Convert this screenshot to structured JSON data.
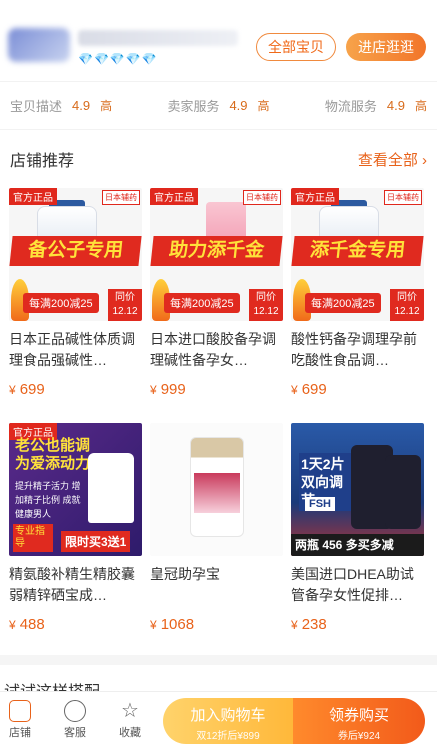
{
  "header": {
    "rating_diamonds": "💎💎💎💎💎",
    "all_products_label": "全部宝贝",
    "visit_shop_label": "进店逛逛"
  },
  "ratings": [
    {
      "label": "宝贝描述",
      "score": "4.9",
      "level": "高"
    },
    {
      "label": "卖家服务",
      "score": "4.9",
      "level": "高"
    },
    {
      "label": "物流服务",
      "score": "4.9",
      "level": "高"
    }
  ],
  "recommend": {
    "title": "店铺推荐",
    "see_all": "查看全部 ›"
  },
  "products": [
    {
      "title": "日本正品碱性体质调理食品强碱性…",
      "price": "699",
      "tag": "官方正品",
      "origin": "日本辅药",
      "banner": "备公子专用",
      "promo": "每满200减25",
      "same": "同价 12.12"
    },
    {
      "title": "日本进口酸胶备孕调理碱性备孕女…",
      "price": "999",
      "tag": "官方正品",
      "origin": "日本辅药",
      "banner": "助力添千金",
      "promo": "每满200减25",
      "same": "同价 12.12"
    },
    {
      "title": "酸性钙备孕调理孕前吃酸性食品调…",
      "price": "699",
      "tag": "官方正品",
      "origin": "日本辅药",
      "banner": "添千金专用",
      "promo": "每满200减25",
      "same": "同价 12.12"
    },
    {
      "title": "精氨酸补精生精胶囊弱精锌硒宝成…",
      "price": "488",
      "tag": "官方正品",
      "headline": "老公也能调 为爱添动力",
      "sub": "提升精子活力 增加精子比例 成就健康男人",
      "special": "专业指导",
      "limited": "限时买3送1"
    },
    {
      "title": "皇冠助孕宝",
      "price": "1068"
    },
    {
      "title": "美国进口DHEA助试管备孕女性促排…",
      "price": "238",
      "headline": "1天2片 双向调节",
      "fsh": "FSH",
      "footer": "两瓶 456 多买多减"
    }
  ],
  "try_section": {
    "title": "试试这样搭配"
  },
  "tabbar": {
    "shop": "店铺",
    "service": "客服",
    "favorite": "收藏",
    "add_to_cart": "加入购物车",
    "cart_sub": "双12折后¥899",
    "buy": "领券购买",
    "buy_sub": "券后¥924"
  },
  "colors": {
    "accent": "#e8621a",
    "red": "#e0281d"
  }
}
